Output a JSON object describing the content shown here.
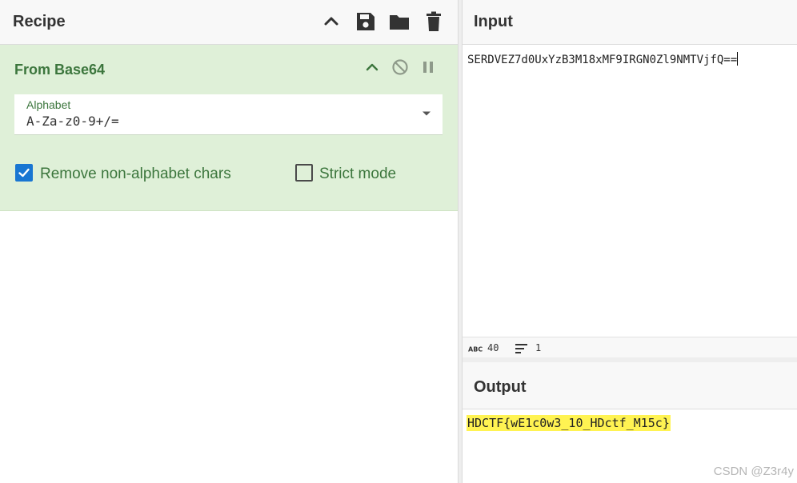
{
  "recipe": {
    "title": "Recipe",
    "icons": [
      "chevron-up-icon",
      "save-icon",
      "folder-icon",
      "trash-icon"
    ],
    "operation": {
      "name": "From Base64",
      "icons": [
        "chevron-up-icon",
        "disable-icon",
        "pause-icon"
      ],
      "alphabet": {
        "label": "Alphabet",
        "value": "A-Za-z0-9+/="
      },
      "remove_non_alphabet": {
        "label": "Remove non-alphabet chars",
        "checked": true
      },
      "strict_mode": {
        "label": "Strict mode",
        "checked": false
      }
    }
  },
  "input": {
    "title": "Input",
    "text": "SERDVEZ7d0UxYzB3M18xMF9IRGN0Zl9NMTVjfQ==",
    "stats": {
      "length": "40",
      "lines": "1"
    }
  },
  "output": {
    "title": "Output",
    "text": "HDCTF{wE1c0w3_10_HDctf_M15c}"
  },
  "watermark": "CSDN @Z3r4y",
  "colors": {
    "op_bg": "#dff0d8",
    "op_text": "#3c763d",
    "checkbox_checked": "#1976d2",
    "highlight": "#fff352"
  }
}
